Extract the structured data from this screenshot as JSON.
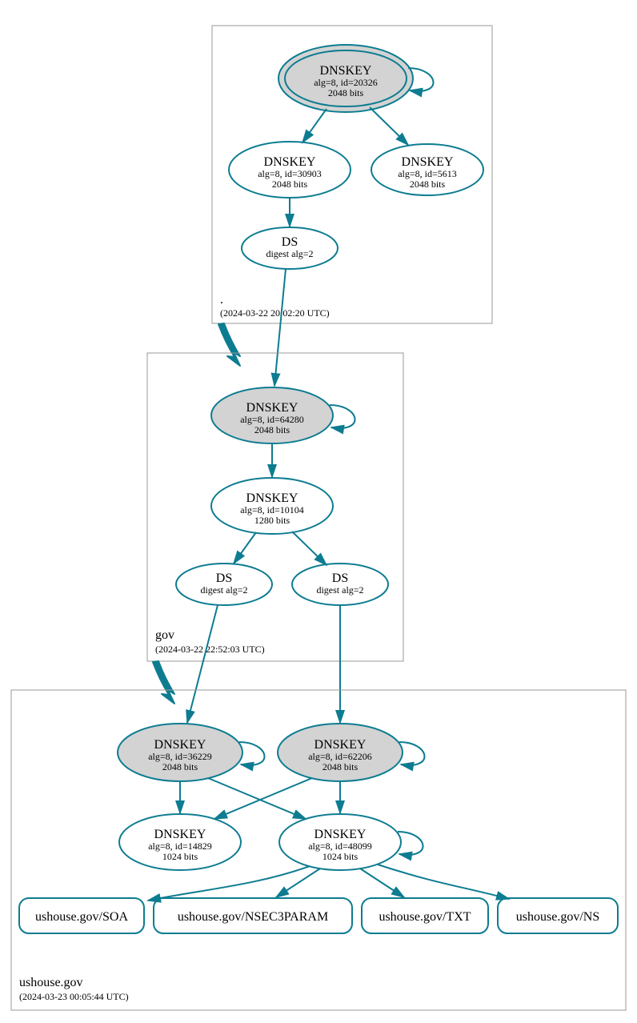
{
  "zones": {
    "root": {
      "name": ".",
      "timestamp": "(2024-03-22 20:02:20 UTC)"
    },
    "gov": {
      "name": "gov",
      "timestamp": "(2024-03-22 22:52:03 UTC)"
    },
    "ushouse": {
      "name": "ushouse.gov",
      "timestamp": "(2024-03-23 00:05:44 UTC)"
    }
  },
  "nodes": {
    "root_ksk": {
      "title": "DNSKEY",
      "l1": "alg=8, id=20326",
      "l2": "2048 bits"
    },
    "root_zsk": {
      "title": "DNSKEY",
      "l1": "alg=8, id=30903",
      "l2": "2048 bits"
    },
    "root_zsk2": {
      "title": "DNSKEY",
      "l1": "alg=8, id=5613",
      "l2": "2048 bits"
    },
    "root_ds": {
      "title": "DS",
      "l1": "digest alg=2"
    },
    "gov_ksk": {
      "title": "DNSKEY",
      "l1": "alg=8, id=64280",
      "l2": "2048 bits"
    },
    "gov_zsk": {
      "title": "DNSKEY",
      "l1": "alg=8, id=10104",
      "l2": "1280 bits"
    },
    "gov_ds1": {
      "title": "DS",
      "l1": "digest alg=2"
    },
    "gov_ds2": {
      "title": "DS",
      "l1": "digest alg=2"
    },
    "uh_ksk1": {
      "title": "DNSKEY",
      "l1": "alg=8, id=36229",
      "l2": "2048 bits"
    },
    "uh_ksk2": {
      "title": "DNSKEY",
      "l1": "alg=8, id=62206",
      "l2": "2048 bits"
    },
    "uh_zsk1": {
      "title": "DNSKEY",
      "l1": "alg=8, id=14829",
      "l2": "1024 bits"
    },
    "uh_zsk2": {
      "title": "DNSKEY",
      "l1": "alg=8, id=48099",
      "l2": "1024 bits"
    }
  },
  "rr": {
    "soa": "ushouse.gov/SOA",
    "nsec": "ushouse.gov/NSEC3PARAM",
    "txt": "ushouse.gov/TXT",
    "ns": "ushouse.gov/NS"
  }
}
